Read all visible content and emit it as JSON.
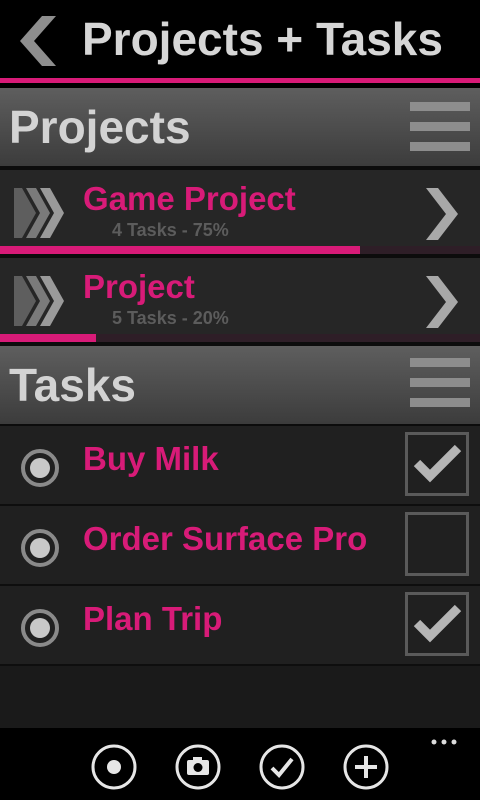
{
  "header": {
    "title": "Projects + Tasks"
  },
  "colors": {
    "accent": "#d81b78",
    "progress_track": "#2e1e27"
  },
  "projects_section": {
    "title": "Projects"
  },
  "projects": [
    {
      "name": "Game Project",
      "meta": "4 Tasks - 75%",
      "progress": 0.75
    },
    {
      "name": "Project",
      "meta": "5 Tasks - 20%",
      "progress": 0.2
    }
  ],
  "tasks_section": {
    "title": "Tasks"
  },
  "tasks": [
    {
      "name": "Buy Milk",
      "checked": true
    },
    {
      "name": "Order Surface Pro",
      "checked": false
    },
    {
      "name": "Plan Trip",
      "checked": true
    }
  ],
  "app_bar": {
    "buttons": [
      "record-icon",
      "camera-icon",
      "check-icon",
      "add-icon"
    ],
    "more_icon": "more-dots-icon"
  }
}
